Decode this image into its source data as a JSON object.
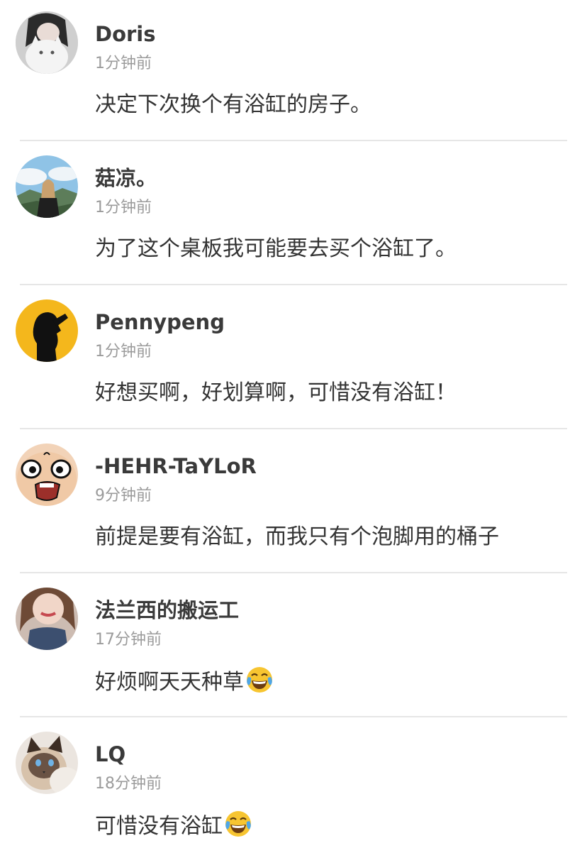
{
  "comments": [
    {
      "username": "Doris",
      "time": "1分钟前",
      "text": "决定下次换个有浴缸的房子。",
      "avatar": "girl-with-white-cat-avatar"
    },
    {
      "username": "菇凉。",
      "time": "1分钟前",
      "text": "为了这个桌板我可能要去买个浴缸了。",
      "avatar": "girl-on-mountain-avatar"
    },
    {
      "username": "Pennypeng",
      "time": "1分钟前",
      "text": "好想买啊，好划算啊，可惜没有浴缸！",
      "avatar": "silhouette-on-yellow-avatar"
    },
    {
      "username": "-HEHR-TaYLoR",
      "time": "9分钟前",
      "text": "前提是要有浴缸，而我只有个泡脚用的桶子",
      "avatar": "cartoon-face-avatar"
    },
    {
      "username": "法兰西的搬运工",
      "time": "17分钟前",
      "text": "好烦啊天天种草",
      "avatar": "woman-portrait-avatar",
      "emoji": "face-with-tears-of-joy-icon"
    },
    {
      "username": "LQ",
      "time": "18分钟前",
      "text": "可惜没有浴缸",
      "avatar": "cat-avatar",
      "emoji": "face-with-tears-of-joy-icon"
    }
  ]
}
